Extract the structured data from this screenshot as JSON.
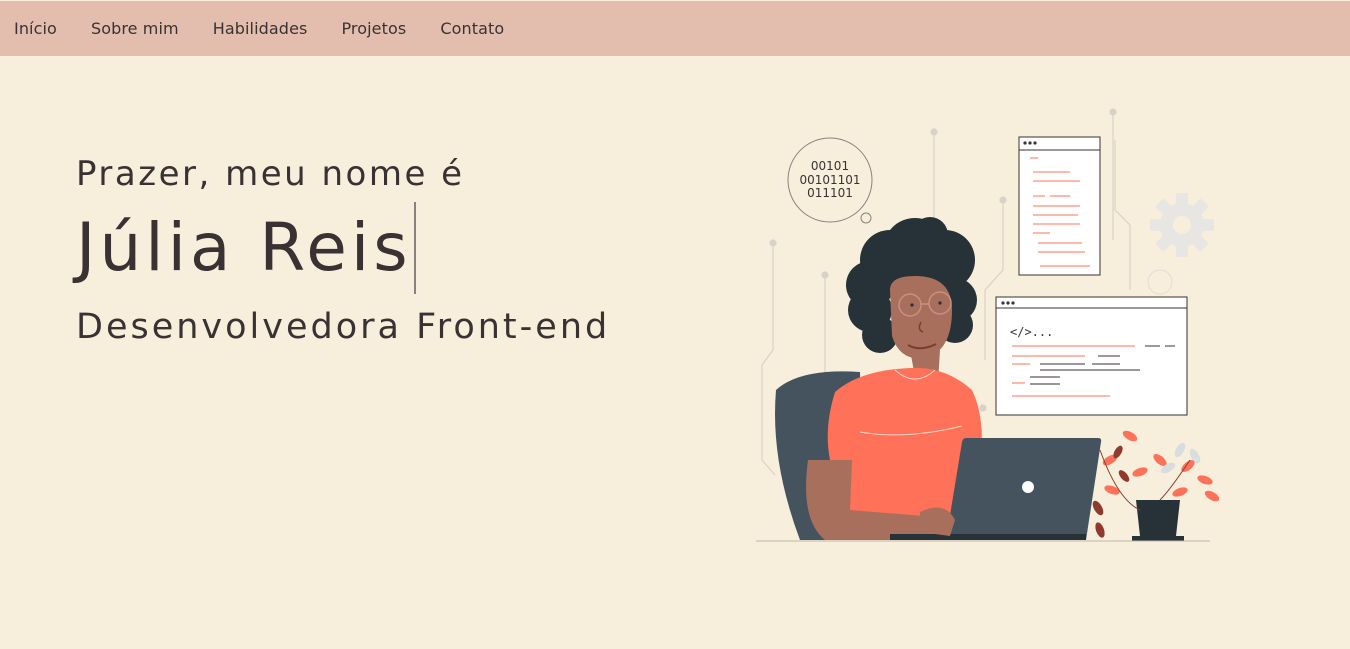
{
  "nav": {
    "items": [
      {
        "label": "Início"
      },
      {
        "label": "Sobre mim"
      },
      {
        "label": "Habilidades"
      },
      {
        "label": "Projetos"
      },
      {
        "label": "Contato"
      }
    ]
  },
  "hero": {
    "greeting": "Prazer, meu nome é",
    "name": "Júlia Reis",
    "role": "Desenvolvedora Front-end"
  },
  "illustration": {
    "binary_lines": [
      "00101",
      "00101101",
      "011101"
    ],
    "code_tag": "</>..."
  },
  "colors": {
    "background": "#f7efdc",
    "navbar": "#e3beae",
    "text": "#3a3232",
    "accent": "#ff7158"
  }
}
